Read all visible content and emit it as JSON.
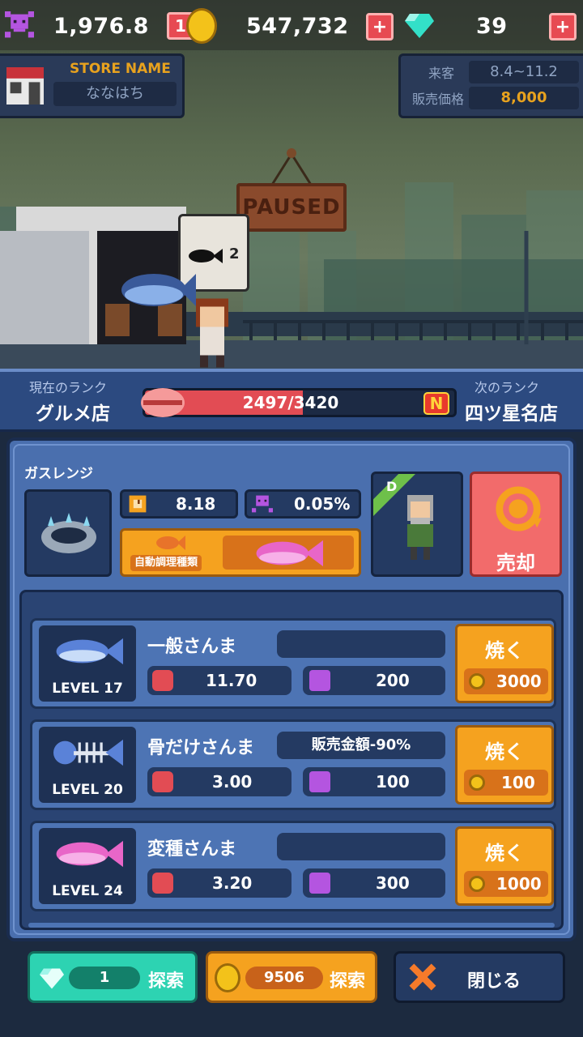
{
  "top": {
    "skulls": "1,976.8",
    "skull_badge": "1",
    "coins": "547,732",
    "gems": "39",
    "plus": "+"
  },
  "store": {
    "label": "STORE NAME",
    "name": "ななはち"
  },
  "info": {
    "visitors_label": "来客",
    "visitors_value": "8.4~11.2",
    "price_label": "販売価格",
    "price_value": "8,000"
  },
  "scene": {
    "sign": "PAUSED",
    "bubble_count": "2"
  },
  "rank": {
    "current_label": "現在のランク",
    "current": "グルメ店",
    "progress_text": "2497/3420",
    "progress_current": 2497,
    "progress_max": 3420,
    "new_badge": "N",
    "next_label": "次のランク",
    "next": "四ツ星名店"
  },
  "stove": {
    "label": "ガスレンジ",
    "time": "8.18",
    "rate": "0.05%",
    "auto_label": "自動調理種類",
    "chef_grade": "D",
    "sell_label": "売却"
  },
  "fish": [
    {
      "name": "一般さんま",
      "level": "LEVEL 17",
      "tag": "",
      "time": "11.70",
      "skull": "200",
      "cook": "焼く",
      "cost": "3000"
    },
    {
      "name": "骨だけさんま",
      "level": "LEVEL 20",
      "tag": "販売金額-90%",
      "time": "3.00",
      "skull": "100",
      "cook": "焼く",
      "cost": "100"
    },
    {
      "name": "変種さんま",
      "level": "LEVEL 24",
      "tag": "",
      "time": "3.20",
      "skull": "300",
      "cook": "焼く",
      "cost": "1000"
    }
  ],
  "bottom": {
    "gem_count": "1",
    "gem_label": "探索",
    "coin_count": "9506",
    "coin_label": "探索",
    "close_label": "閉じる"
  },
  "colors": {
    "accent_orange": "#f5a21f",
    "accent_red": "#e24c54",
    "teal": "#2dd3b2",
    "panel_blue": "#4a6fae"
  }
}
